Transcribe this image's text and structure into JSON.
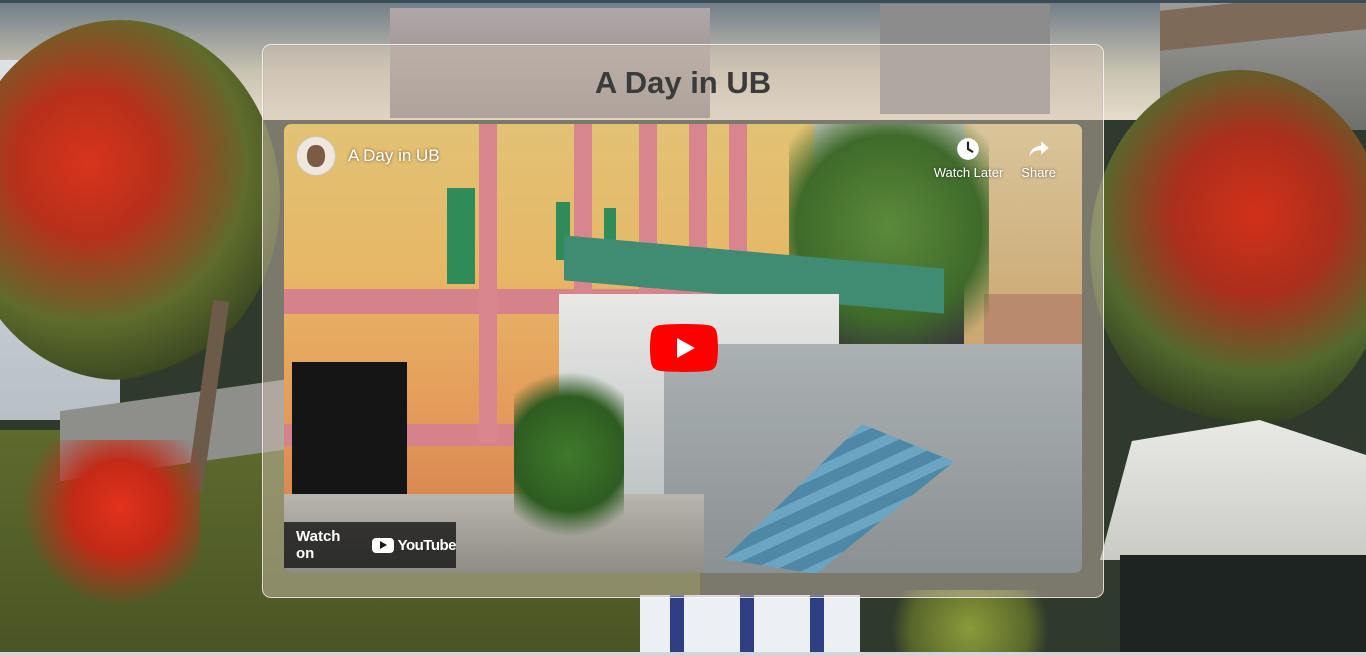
{
  "page": {
    "title": "A Day in UB"
  },
  "video": {
    "title": "A Day in UB",
    "watch_later_label": "Watch Later",
    "share_label": "Share",
    "watch_on_label": "Watch on",
    "brand_label": "YouTube",
    "play_color": "#ff0000"
  },
  "icons": {
    "watch_later": "clock-icon",
    "share": "share-arrow-icon",
    "play": "play-icon",
    "brand": "youtube-logo-icon"
  }
}
